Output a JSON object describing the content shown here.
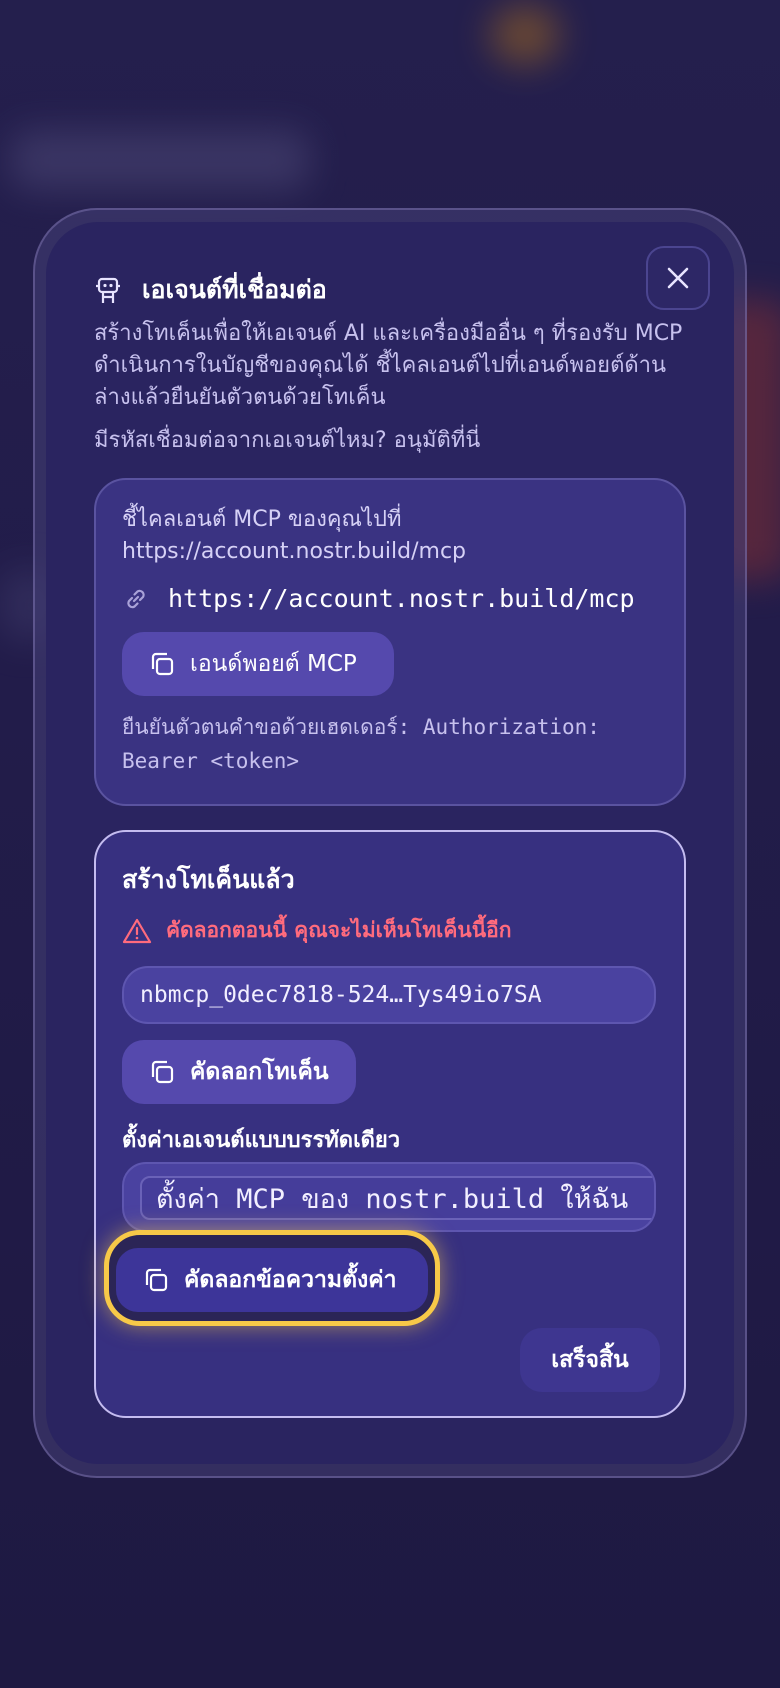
{
  "dialog": {
    "title": "เอเจนต์ที่เชื่อมต่อ",
    "description": "สร้างโทเค็นเพื่อให้เอเจนต์ AI และเครื่องมืออื่น ๆ ที่รองรับ MCP ดำเนินการในบัญชีของคุณได้ ชี้ไคลเอนต์ไปที่เอนด์พอยต์ด้านล่างแล้วยืนยันตัวตนด้วยโทเค็น",
    "approve_prompt": "มีรหัสเชื่อมต่อจากเอเจนต์ไหม? อนุมัติที่นี่",
    "icons": {
      "title": "robot-icon",
      "close": "close-icon"
    }
  },
  "endpoint_card": {
    "label": "ชี้ไคลเอนต์ MCP ของคุณไปที่ https://account.nostr.build/mcp",
    "url": "https://account.nostr.build/mcp",
    "copy_button": "เอนด์พอยต์ MCP",
    "auth_note": "ยืนยันตัวตนคำขอด้วยเฮดเดอร์: Authorization: Bearer <token>",
    "icons": {
      "url": "link-icon",
      "copy": "copy-icon"
    }
  },
  "token_card": {
    "title": "สร้างโทเค็นแล้ว",
    "warning": "คัดลอกตอนนี้ คุณจะไม่เห็นโทเค็นนี้อีก",
    "token_value": "nbmcp_0dec7818-524…Tys49io7SA",
    "copy_token_button": "คัดลอกโทเค็น",
    "oneliner_label": "ตั้งค่าเอเจนต์แบบบรรทัดเดียว",
    "oneliner_value": "ตั้งค่า MCP ของ nostr.build ให้ฉัน",
    "copy_config_button": "คัดลอกข้อความตั้งค่า",
    "done_button": "เสร็จสิ้น",
    "icons": {
      "warning": "warning-icon",
      "copy": "copy-icon"
    }
  },
  "colors": {
    "accent": "#5549ad",
    "warning": "#ff6b7d",
    "highlight": "#f7c948",
    "background": "#2a2460"
  }
}
